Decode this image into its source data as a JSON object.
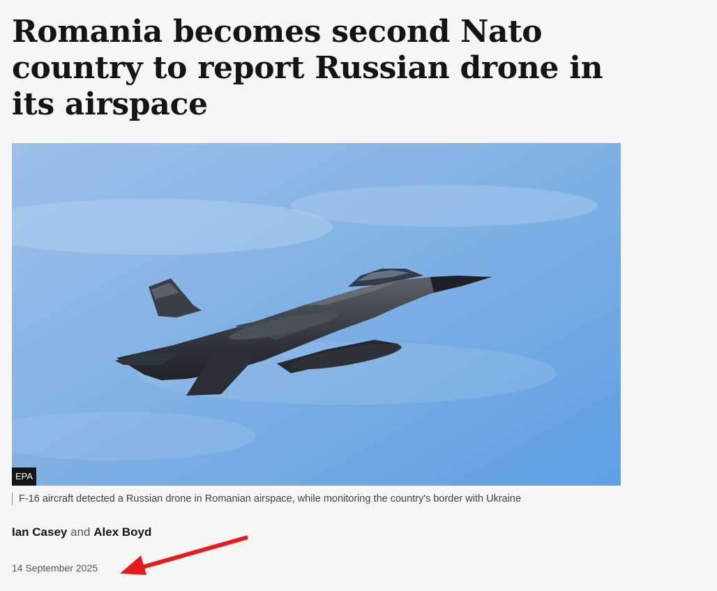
{
  "article": {
    "headline": "Romania becomes second Nato country to report Russian drone in its airspace",
    "image": {
      "credit": "EPA",
      "caption": "F-16 aircraft detected a Russian drone in Romanian airspace, while monitoring the country's border with Ukraine"
    },
    "byline": {
      "author_1": "Ian Casey",
      "conjunction": "and",
      "author_2": "Alex Boyd"
    },
    "date": "14 September 2025"
  },
  "colors": {
    "background": "#f6f6f6",
    "headline_text": "#141414",
    "credit_background": "#141414",
    "annotation_arrow": "#e81b1b"
  },
  "icons": {
    "annotation": "red-arrow-icon"
  }
}
